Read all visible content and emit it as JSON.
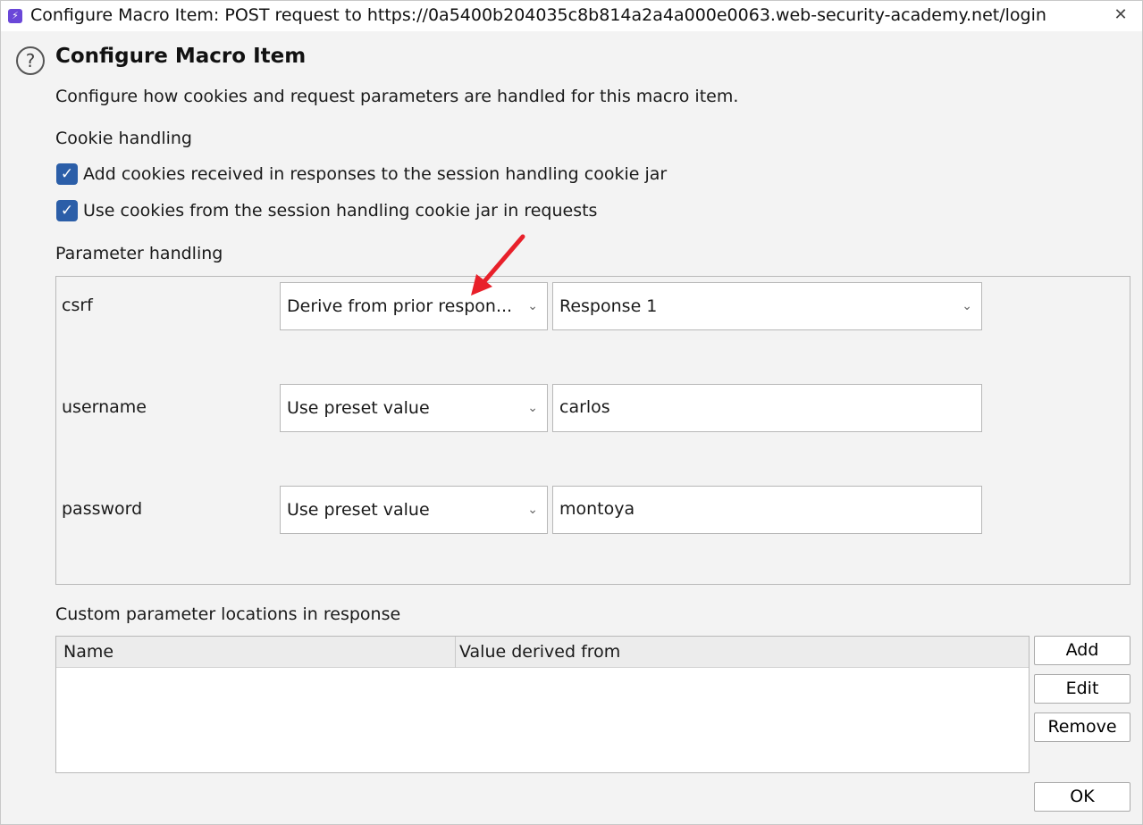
{
  "window": {
    "title": "Configure Macro Item: POST request to https://0a5400b204035c8b814a2a4a000e0063.web-security-academy.net/login",
    "close_glyph": "✕"
  },
  "header": {
    "help_glyph": "?",
    "heading": "Configure Macro Item",
    "description": "Configure how cookies and request parameters are handled for this macro item."
  },
  "cookie_handling": {
    "label": "Cookie handling",
    "options": [
      {
        "label": "Add cookies received in responses to the session handling cookie jar",
        "checked": true
      },
      {
        "label": "Use cookies from the session handling cookie jar in requests",
        "checked": true
      }
    ]
  },
  "parameter_handling": {
    "label": "Parameter handling",
    "params": [
      {
        "name": "csrf",
        "mode": "Derive from prior respon...",
        "value": "Response 1",
        "value_is_dropdown": true
      },
      {
        "name": "username",
        "mode": "Use preset value",
        "value": "carlos",
        "value_is_dropdown": false
      },
      {
        "name": "password",
        "mode": "Use preset value",
        "value": "montoya",
        "value_is_dropdown": false
      }
    ]
  },
  "custom_locations": {
    "label": "Custom parameter locations in response",
    "columns": [
      "Name",
      "Value derived from"
    ],
    "rows": []
  },
  "buttons": {
    "add": "Add",
    "edit": "Edit",
    "remove": "Remove",
    "ok": "OK"
  },
  "colors": {
    "checkbox": "#2b5ea8",
    "annotation_arrow": "#e8202a",
    "app_icon": "#6a47d8"
  }
}
